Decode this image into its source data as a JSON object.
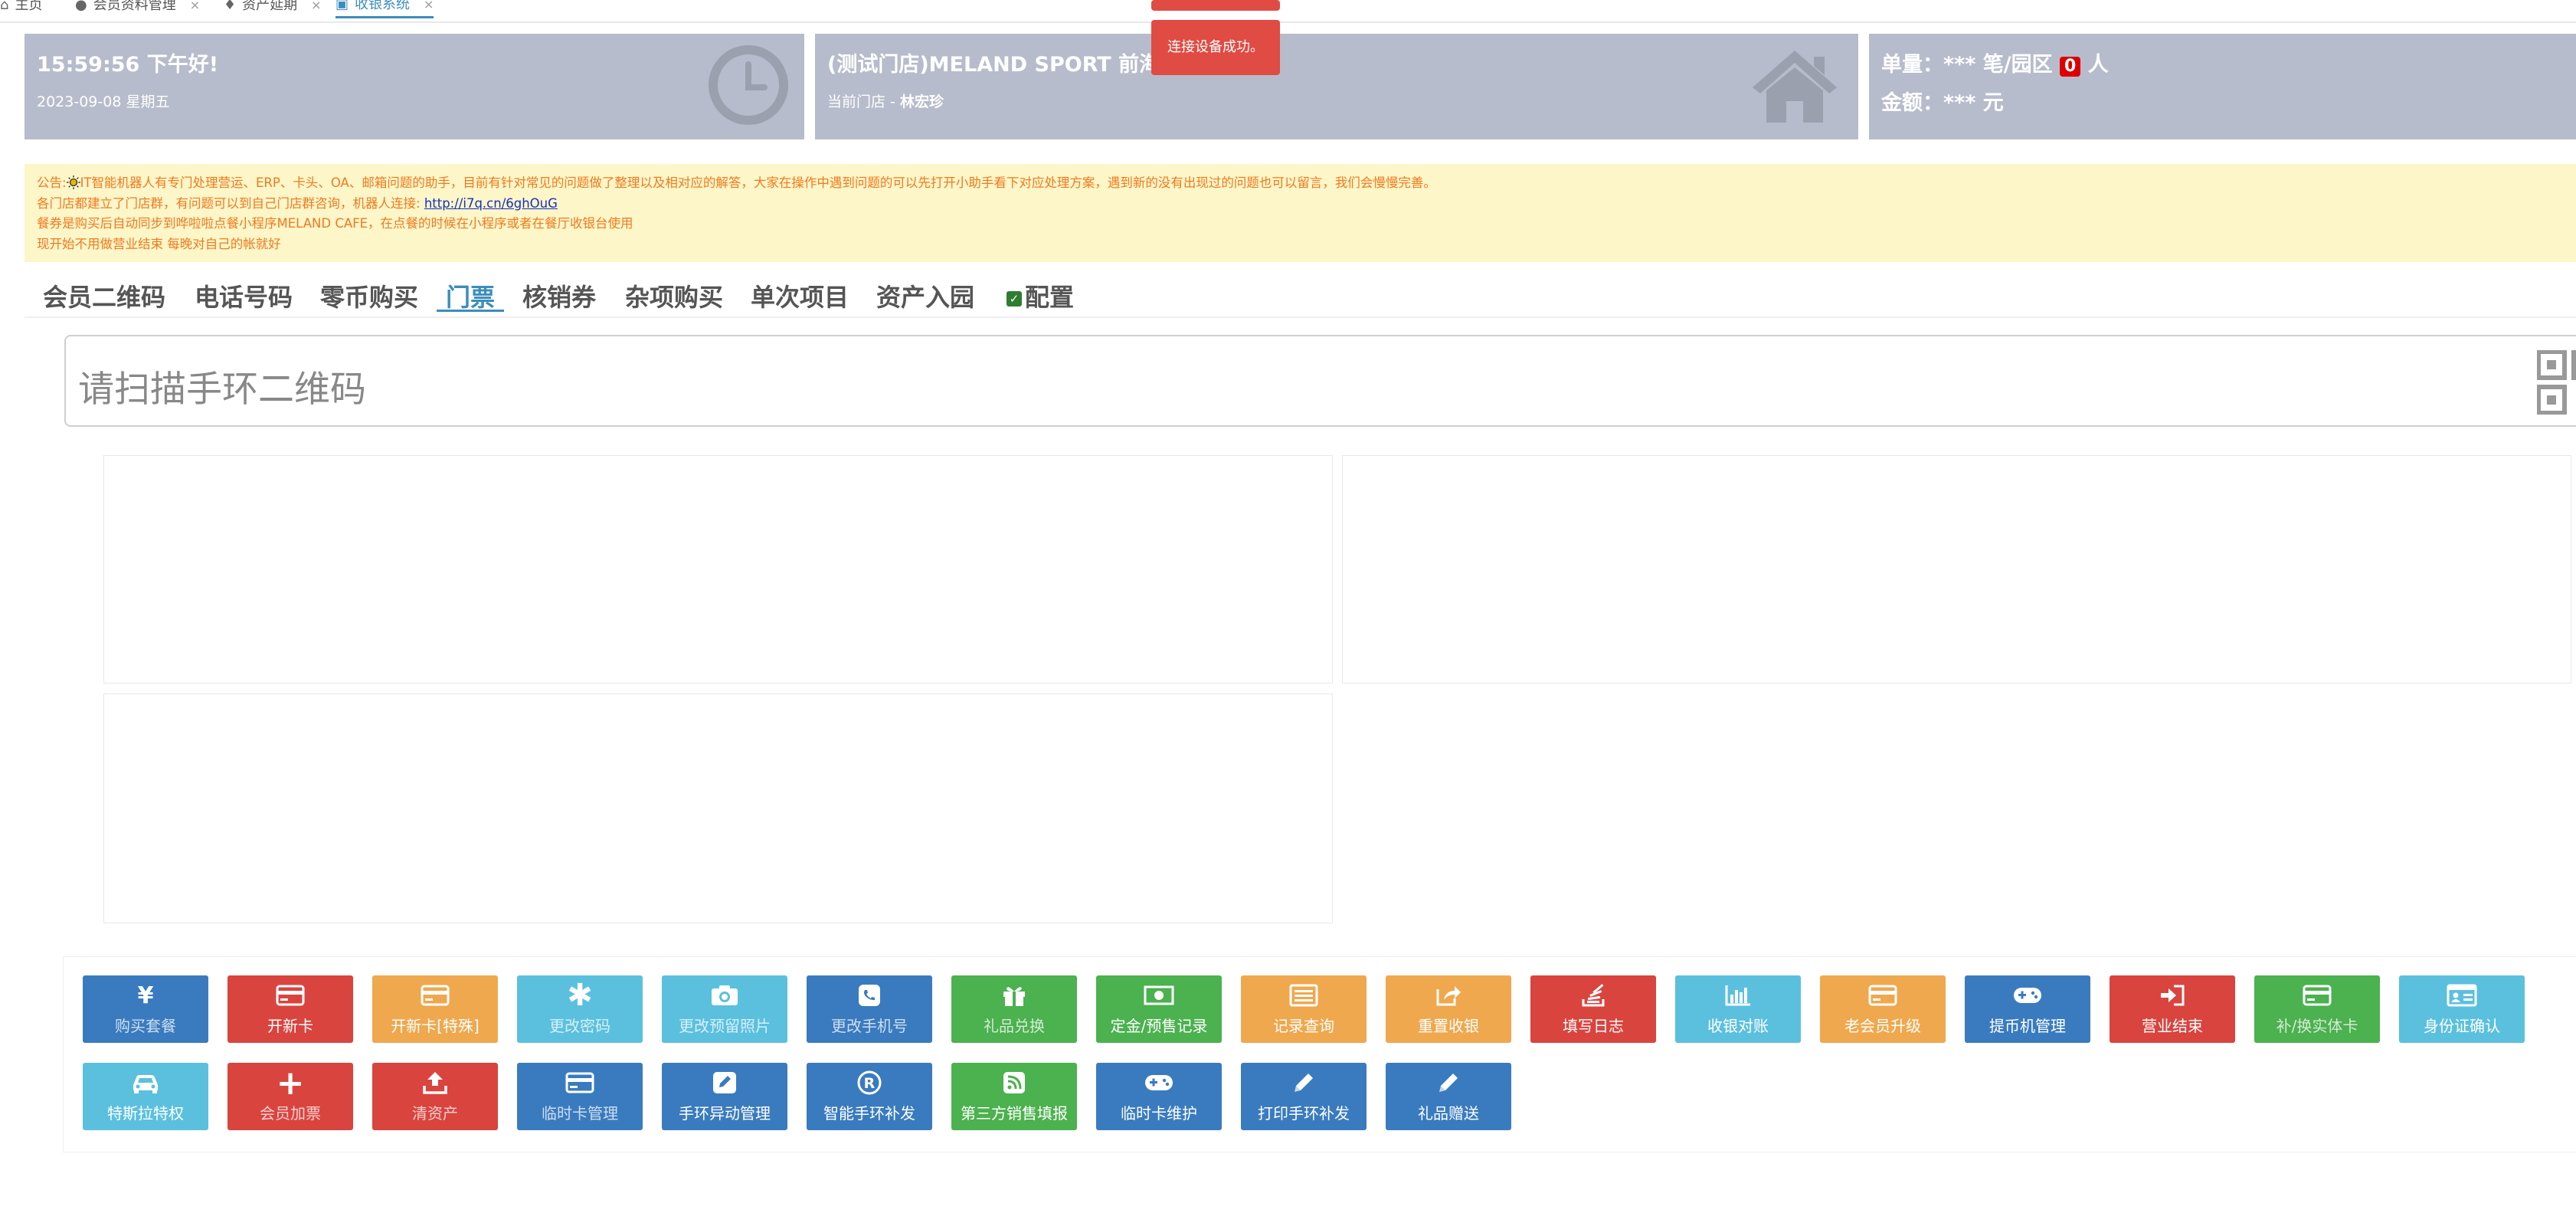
{
  "tabs": [
    {
      "label": "主页",
      "icon": "home-icon"
    },
    {
      "label": "会员资料管理",
      "icon": "users-icon"
    },
    {
      "label": "资产延期",
      "icon": "bell-icon"
    },
    {
      "label": "收银系统",
      "icon": "laptop-icon"
    }
  ],
  "toasts": [
    "",
    "连接设备成功。"
  ],
  "panel_time": {
    "time_greeting": "15:59:56 下午好!",
    "date": "2023-09-08 星期五"
  },
  "panel_store": {
    "store_name": "(测试门店)MELAND SPORT 前海",
    "store_prefix": "当前门店 - ",
    "staff": "林宏珍"
  },
  "panel_stats": {
    "orders_prefix": "单量：*** 笔/园区",
    "visitors": "0",
    "visitors_unit": "人",
    "amount": "金额：*** 元"
  },
  "notice": {
    "line1_prefix": "公告:",
    "line1": "IT智能机器人有专门处理营运、ERP、卡头、OA、邮箱问题的助手，目前有针对常见的问题做了整理以及相对应的解答，大家在操作中遇到问题的可以先打开小助手看下对应处理方案，遇到新的没有出现过的问题也可以留言，我们会慢慢完善。",
    "line2_text": "各门店都建立了门店群，有问题可以到自己门店群咨询，机器人连接: ",
    "line2_link": "http://i7q.cn/6ghOuG",
    "line3": "餐券是购买后自动同步到哗啦啦点餐小程序MELAND CAFE，在点餐的时候在小程序或者在餐厅收银台使用",
    "line4": "现开始不用做营业结束 每晚对自己的帐就好"
  },
  "func_tabs": [
    "会员二维码",
    "电话号码",
    "零币购买",
    "门票",
    "核销券",
    "杂项购买",
    "单次项目",
    "资产入园",
    "配置"
  ],
  "active_func_tab": "门票",
  "scan": {
    "placeholder": "请扫描手环二维码"
  },
  "buttons": [
    {
      "label": "购买套餐",
      "icon": "yen-icon",
      "color": "#3a7bbf"
    },
    {
      "label": "开新卡",
      "icon": "credit-card-icon",
      "color": "#d9443f"
    },
    {
      "label": "开新卡[特殊]",
      "icon": "credit-card-icon",
      "color": "#efa84e"
    },
    {
      "label": "更改密码",
      "icon": "asterisk-icon",
      "color": "#5bc0de"
    },
    {
      "label": "更改预留照片",
      "icon": "camera-icon",
      "color": "#5bc0de"
    },
    {
      "label": "更改手机号",
      "icon": "phone-icon",
      "color": "#3a7bbf"
    },
    {
      "label": "礼品兑换",
      "icon": "gift-icon",
      "color": "#4cb14f"
    },
    {
      "label": "定金/预售记录",
      "icon": "money-icon",
      "color": "#4cb14f"
    },
    {
      "label": "记录查询",
      "icon": "list-icon",
      "color": "#efa84e"
    },
    {
      "label": "重置收银",
      "icon": "share-icon",
      "color": "#efa84e"
    },
    {
      "label": "填写日志",
      "icon": "stack-icon",
      "color": "#d9443f"
    },
    {
      "label": "收银对账",
      "icon": "bar-chart-icon",
      "color": "#5bc0de"
    },
    {
      "label": "老会员升级",
      "icon": "credit-card-icon",
      "color": "#efa84e"
    },
    {
      "label": "提币机管理",
      "icon": "gamepad-icon",
      "color": "#3a7bbf"
    },
    {
      "label": "营业结束",
      "icon": "sign-in-icon",
      "color": "#d9443f"
    },
    {
      "label": "补/换实体卡",
      "icon": "credit-card-icon",
      "color": "#4cb14f"
    },
    {
      "label": "身份证确认",
      "icon": "id-card-icon",
      "color": "#5bc0de"
    },
    {
      "label": "特斯拉特权",
      "icon": "car-icon",
      "color": "#5bc0de"
    },
    {
      "label": "会员加票",
      "icon": "plus-icon",
      "color": "#d9443f"
    },
    {
      "label": "清资产",
      "icon": "upload-icon",
      "color": "#d9443f"
    },
    {
      "label": "临时卡管理",
      "icon": "credit-card-icon",
      "color": "#3a7bbf"
    },
    {
      "label": "手环异动管理",
      "icon": "edit-icon",
      "color": "#3a7bbf"
    },
    {
      "label": "智能手环补发",
      "icon": "registered-icon",
      "color": "#3a7bbf"
    },
    {
      "label": "第三方销售填报",
      "icon": "rss-icon",
      "color": "#4cb14f"
    },
    {
      "label": "临时卡维护",
      "icon": "gamepad-icon",
      "color": "#3a7bbf"
    },
    {
      "label": "打印手环补发",
      "icon": "pencil-icon",
      "color": "#3a7bbf"
    },
    {
      "label": "礼品赠送",
      "icon": "pencil-icon",
      "color": "#3a7bbf"
    }
  ]
}
